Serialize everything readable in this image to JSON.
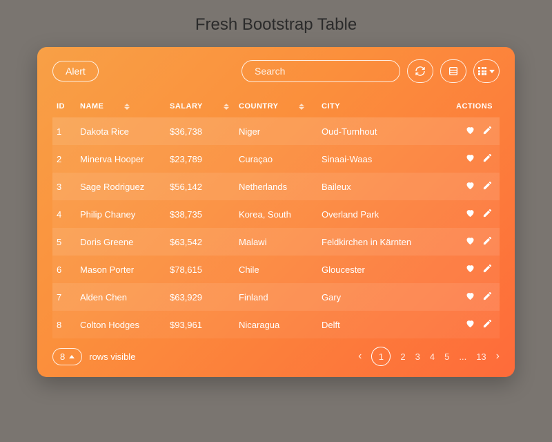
{
  "page": {
    "title": "Fresh Bootstrap Table"
  },
  "toolbar": {
    "alert_label": "Alert",
    "search_placeholder": "Search"
  },
  "columns": {
    "id": "ID",
    "name": "NAME",
    "salary": "SALARY",
    "country": "COUNTRY",
    "city": "CITY",
    "actions": "ACTIONS"
  },
  "rows": [
    {
      "id": "1",
      "name": "Dakota Rice",
      "salary": "$36,738",
      "country": "Niger",
      "city": "Oud-Turnhout"
    },
    {
      "id": "2",
      "name": "Minerva Hooper",
      "salary": "$23,789",
      "country": "Curaçao",
      "city": "Sinaai-Waas"
    },
    {
      "id": "3",
      "name": "Sage Rodriguez",
      "salary": "$56,142",
      "country": "Netherlands",
      "city": "Baileux"
    },
    {
      "id": "4",
      "name": "Philip Chaney",
      "salary": "$38,735",
      "country": "Korea, South",
      "city": "Overland Park"
    },
    {
      "id": "5",
      "name": "Doris Greene",
      "salary": "$63,542",
      "country": "Malawi",
      "city": "Feldkirchen in Kärnten"
    },
    {
      "id": "6",
      "name": "Mason Porter",
      "salary": "$78,615",
      "country": "Chile",
      "city": "Gloucester"
    },
    {
      "id": "7",
      "name": "Alden Chen",
      "salary": "$63,929",
      "country": "Finland",
      "city": "Gary"
    },
    {
      "id": "8",
      "name": "Colton Hodges",
      "salary": "$93,961",
      "country": "Nicaragua",
      "city": "Delft"
    }
  ],
  "footer": {
    "rows_visible_count": "8",
    "rows_visible_label": "rows visible"
  },
  "pagination": {
    "prev": "‹",
    "pages": [
      "1",
      "2",
      "3",
      "4",
      "5",
      "...",
      "13"
    ],
    "active_index": 0,
    "next": "›"
  }
}
